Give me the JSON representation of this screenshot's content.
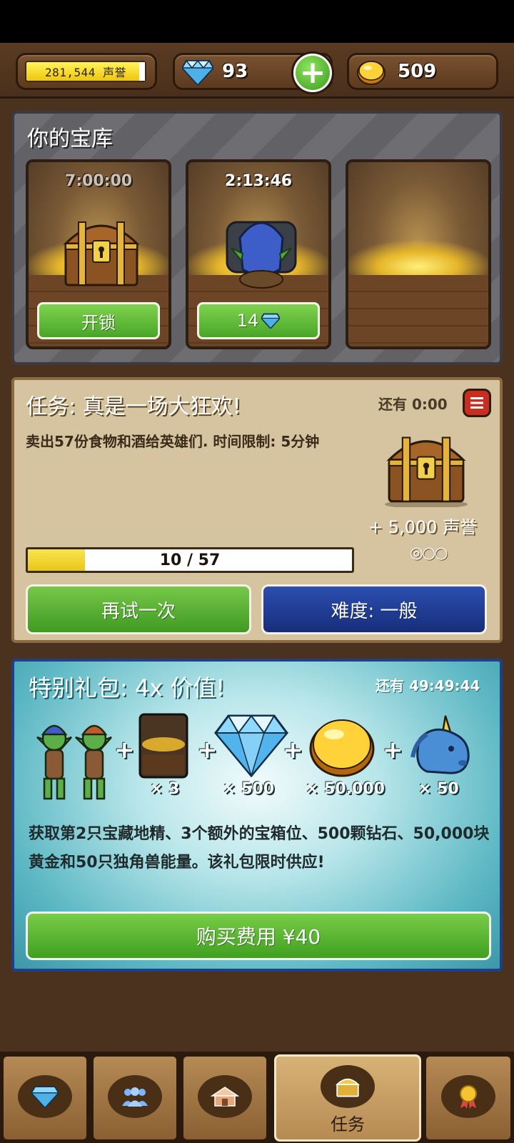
{
  "resources": {
    "reputation": "281,544 声誉",
    "gems": "93",
    "gold": "509"
  },
  "vault": {
    "title": "你的宝库",
    "slots": [
      {
        "timer": "7:00:00",
        "button": "开锁"
      },
      {
        "timer": "2:13:46",
        "button": "14"
      },
      {
        "timer": "",
        "button": ""
      }
    ]
  },
  "mission": {
    "title": "任务: 真是一场大狂欢!",
    "time_left": "还有 0:00",
    "description": "卖出57份食物和酒给英雄们. 时间限制: 5分钟",
    "reward": "+ 5,000 声誉",
    "difficulty_circles": "◎○○",
    "progress_text": "10 / 57",
    "progress_current": 10,
    "progress_total": 57,
    "retry_label": "再试一次",
    "difficulty_label": "难度: 一般"
  },
  "offer": {
    "title": "特别礼包: 4x 价值!",
    "time_left": "还有 49:49:44",
    "items": [
      {
        "icon": "goblin-pair",
        "qty": ""
      },
      {
        "icon": "vault-slot-card",
        "qty": "× 3"
      },
      {
        "icon": "diamond",
        "qty": "× 500"
      },
      {
        "icon": "gold-coin",
        "qty": "× 50.000"
      },
      {
        "icon": "unicorn",
        "qty": "× 50"
      }
    ],
    "description": "获取第2只宝藏地精、3个额外的宝箱位、500颗钻石、50,000块黄金和50只独角兽能量。该礼包限时供应!",
    "buy_label": "购买费用 ¥40"
  },
  "nav": {
    "tabs": [
      {
        "icon": "diamond-icon",
        "label": ""
      },
      {
        "icon": "people-icon",
        "label": ""
      },
      {
        "icon": "shop-icon",
        "label": ""
      },
      {
        "icon": "chest-icon",
        "label": "任务",
        "active": true
      },
      {
        "icon": "medal-icon",
        "label": ""
      }
    ]
  },
  "colors": {
    "accent_green": "#49a628",
    "difficulty_blue": "#172d7a",
    "progress_yellow": "#f0c50d"
  }
}
